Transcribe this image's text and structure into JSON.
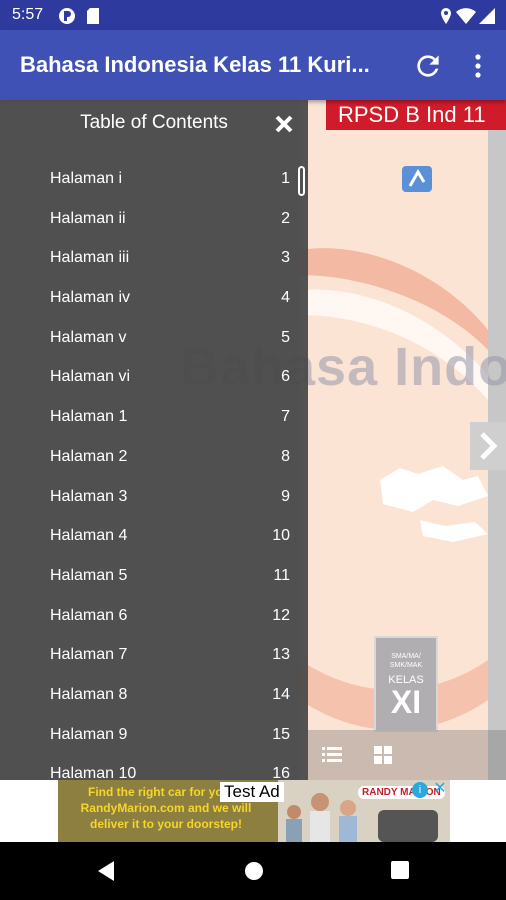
{
  "status_bar": {
    "time": "5:57"
  },
  "app_bar": {
    "title": "Bahasa Indonesia Kelas 11 Kuri...",
    "refresh_icon": "refresh-icon",
    "menu_icon": "more-vert-icon"
  },
  "drawer": {
    "title": "Table of Contents",
    "close_icon": "close-icon",
    "items": [
      {
        "label": "Halaman i",
        "page": "1"
      },
      {
        "label": "Halaman ii",
        "page": "2"
      },
      {
        "label": "Halaman iii",
        "page": "3"
      },
      {
        "label": "Halaman iv",
        "page": "4"
      },
      {
        "label": "Halaman v",
        "page": "5"
      },
      {
        "label": "Halaman vi",
        "page": "6"
      },
      {
        "label": "Halaman 1",
        "page": "7"
      },
      {
        "label": "Halaman 2",
        "page": "8"
      },
      {
        "label": "Halaman 3",
        "page": "9"
      },
      {
        "label": "Halaman 4",
        "page": "10"
      },
      {
        "label": "Halaman 5",
        "page": "11"
      },
      {
        "label": "Halaman 6",
        "page": "12"
      },
      {
        "label": "Halaman 7",
        "page": "13"
      },
      {
        "label": "Halaman 8",
        "page": "14"
      },
      {
        "label": "Halaman 9",
        "page": "15"
      },
      {
        "label": "Halaman 10",
        "page": "16"
      }
    ]
  },
  "book": {
    "badge": "RPSD B Ind 11",
    "watermark": "Bahasa Indonesia",
    "level_top": "SMA/MA/ SMK/MAK",
    "level_label": "KELAS",
    "level_number": "XI"
  },
  "ad": {
    "text": "Find the right car for you at RandyMarion.com and we will deliver it to your doorstep!",
    "label": "Test Ad",
    "brand": "RANDY MARION"
  },
  "colors": {
    "app_bar": "#3f51b5",
    "status_bar": "#2f3a9f",
    "badge": "#d01b2a",
    "drawer": "#484848"
  }
}
